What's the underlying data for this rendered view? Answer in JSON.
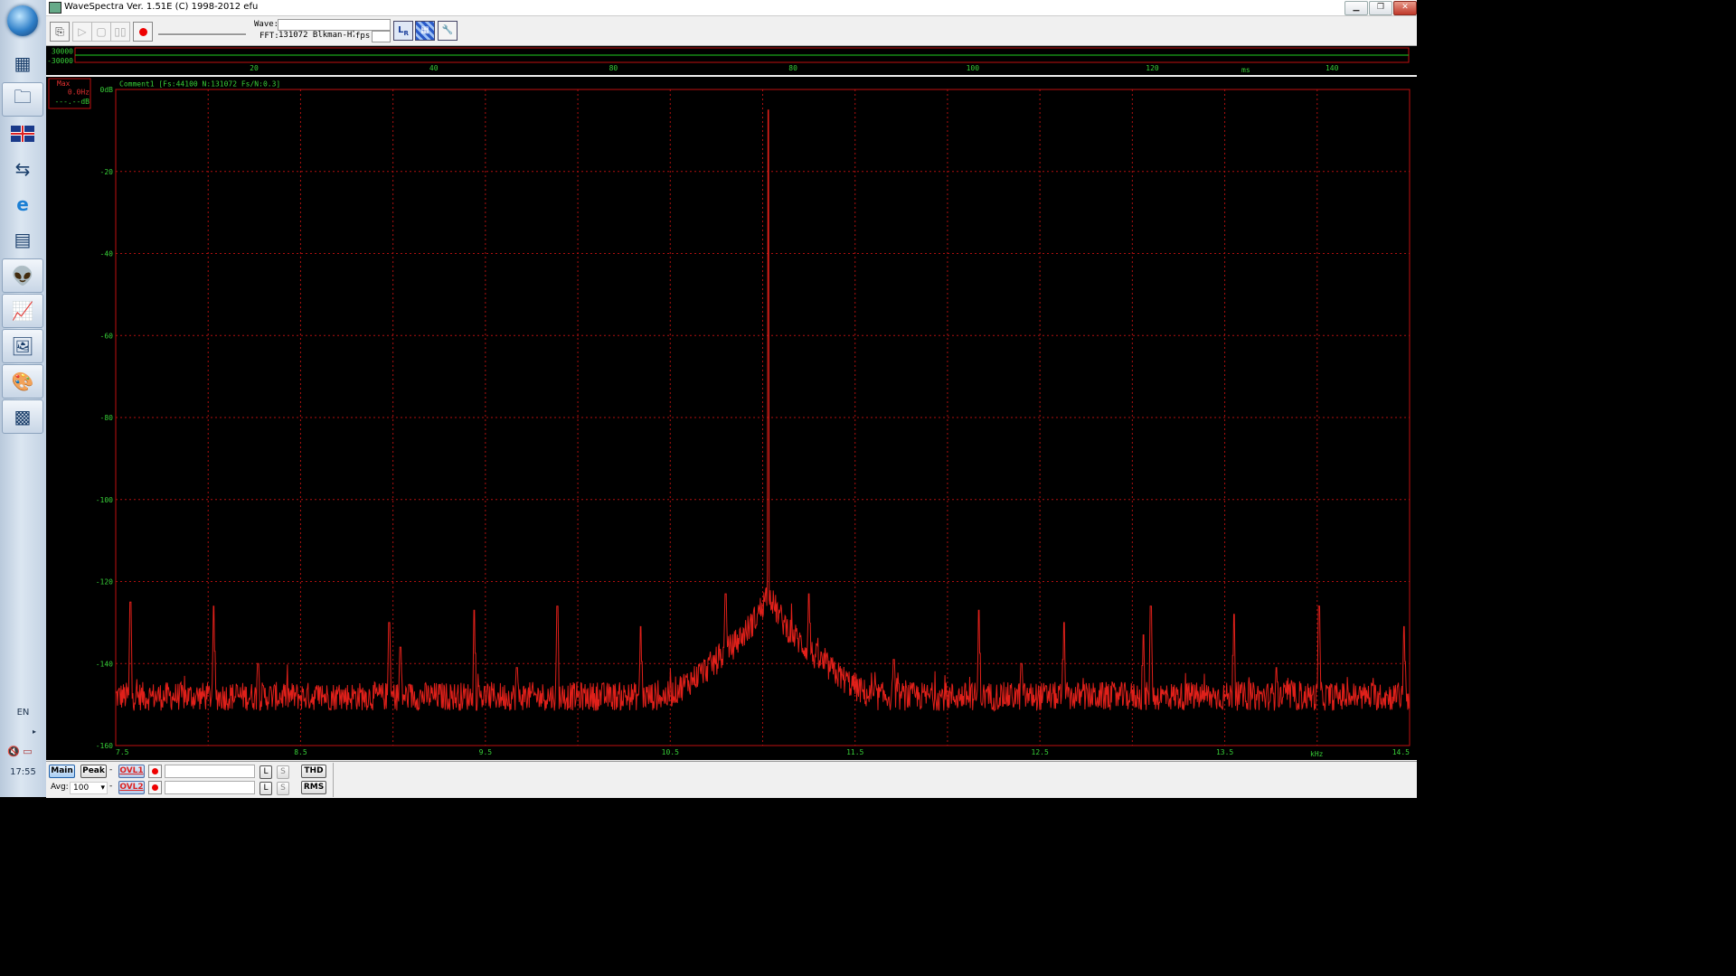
{
  "window": {
    "title": "WaveSpectra  Ver. 1.51E  (C) 1998-2012 efu"
  },
  "taskbar": {
    "language": "EN",
    "clock": "17:55",
    "items": [
      "start-orb",
      "calculator-icon",
      "folder-icon",
      "uk-flag-icon",
      "transfer-arrows-icon",
      "ie-icon",
      "calc2-icon",
      "alien-icon",
      "spectrum-app-icon",
      "picture-viewer-icon",
      "paint-icon",
      "wavespectra-icon"
    ]
  },
  "toolbar": {
    "wave_label": "Wave:",
    "wave_value": "",
    "fft_label": "FFT:",
    "fft_value": "131072 Blkman-H7",
    "fps_label": "fps:",
    "fps_value": ""
  },
  "wave_panel": {
    "y_top_label": "30000",
    "y_bottom_label": "-30000",
    "x_ticks": [
      "20",
      "40",
      "80",
      "80",
      "100",
      "120",
      "140"
    ],
    "x_unit": "ms"
  },
  "fft_panel": {
    "max_label": "Max",
    "max_freq": "0.0Hz",
    "max_db": "---.--dB",
    "comment": "Comment1  [Fs:44100 N:131072 Fs/N:0.3]",
    "x_unit": "kHz"
  },
  "chart_data": {
    "type": "line",
    "title": "",
    "xlabel": "kHz",
    "ylabel": "",
    "xlim": [
      7.5,
      14.5
    ],
    "ylim": [
      -160,
      0
    ],
    "grid": true,
    "x_ticks": [
      7.5,
      8.5,
      9.5,
      10.5,
      11.5,
      12.5,
      13.5,
      14.5
    ],
    "x_tick_labels": [
      "7.5",
      "8.5",
      "9.5",
      "10.5",
      "11.5",
      "12.5",
      "13.5",
      "14.5"
    ],
    "y_ticks": [
      0,
      -20,
      -40,
      -60,
      -80,
      -100,
      -120,
      -140,
      -160
    ],
    "y_tick_labels": [
      "0dB",
      "-20",
      "-40",
      "-60",
      "-80",
      "-100",
      "-120",
      "-140",
      "-160"
    ],
    "series": [
      {
        "noise_floor_db": -151,
        "peak": {
          "x": 11.03,
          "y": -5
        },
        "spurs": [
          {
            "x": 7.58,
            "y": -125
          },
          {
            "x": 8.03,
            "y": -126
          },
          {
            "x": 8.27,
            "y": -140
          },
          {
            "x": 8.98,
            "y": -130
          },
          {
            "x": 9.04,
            "y": -136
          },
          {
            "x": 9.44,
            "y": -127
          },
          {
            "x": 9.67,
            "y": -141
          },
          {
            "x": 9.89,
            "y": -126
          },
          {
            "x": 10.34,
            "y": -131
          },
          {
            "x": 10.8,
            "y": -123
          },
          {
            "x": 11.25,
            "y": -123
          },
          {
            "x": 11.71,
            "y": -139
          },
          {
            "x": 12.17,
            "y": -127
          },
          {
            "x": 12.4,
            "y": -140
          },
          {
            "x": 12.63,
            "y": -130
          },
          {
            "x": 13.06,
            "y": -133
          },
          {
            "x": 13.1,
            "y": -126
          },
          {
            "x": 13.55,
            "y": -128
          },
          {
            "x": 13.78,
            "y": -141
          },
          {
            "x": 14.01,
            "y": -126
          },
          {
            "x": 14.47,
            "y": -131
          }
        ]
      }
    ],
    "colors": {
      "trace": "#e0201a",
      "grid": "#b01010",
      "labels": "#38d038"
    }
  },
  "bottom": {
    "main": "Main",
    "peak": "Peak",
    "dash1": "-",
    "dash2": "-",
    "ovl1": "OVL1",
    "ovl2": "OVL2",
    "l": "L",
    "s": "S",
    "thd": "THD",
    "rms": "RMS",
    "avg_label": "Avg:",
    "avg_value": "100"
  }
}
